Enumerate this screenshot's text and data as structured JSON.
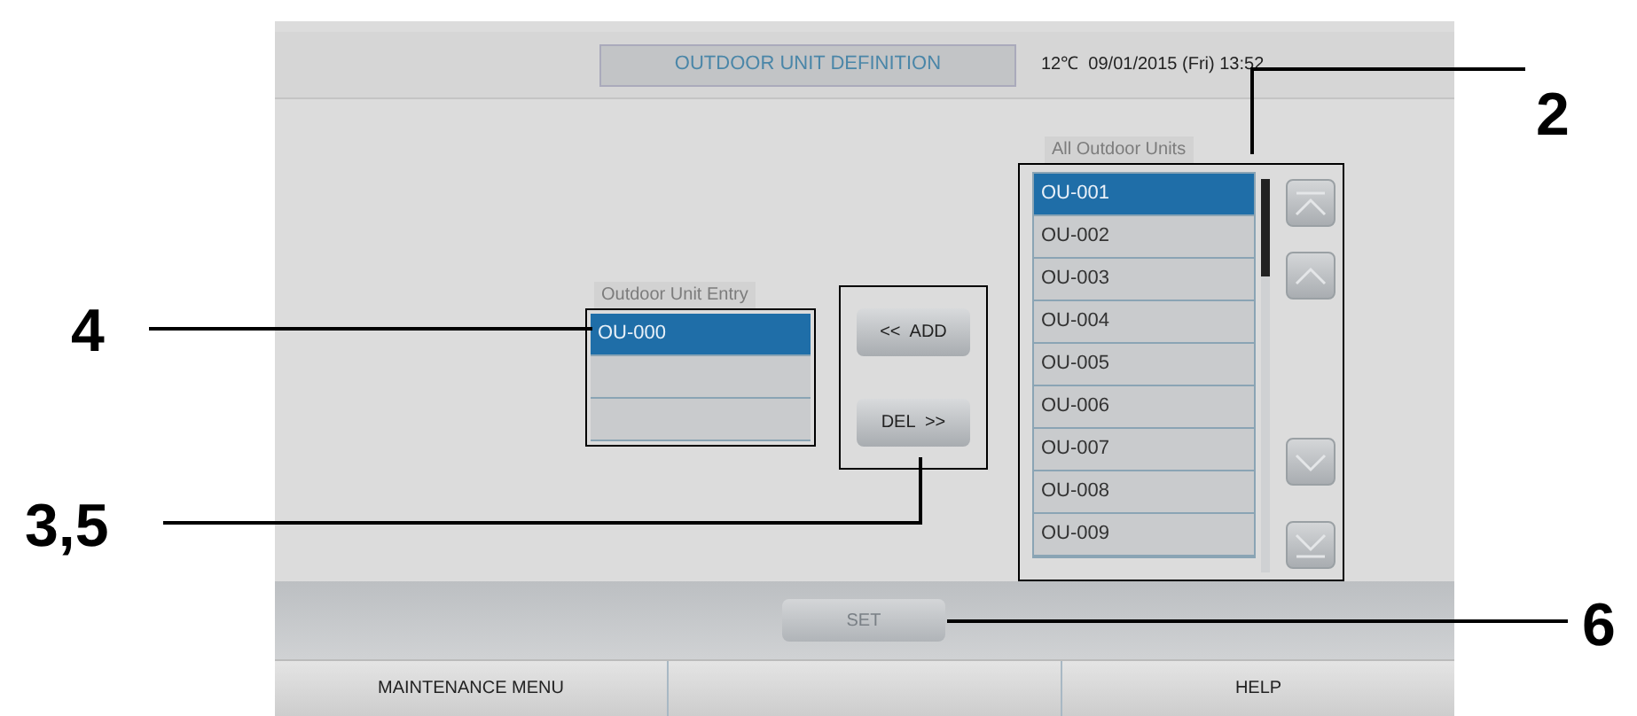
{
  "header": {
    "title": "OUTDOOR UNIT DEFINITION",
    "status": "12℃  09/01/2015 (Fri) 13:52"
  },
  "entry_list": {
    "label": "Outdoor Unit Entry",
    "rows": [
      {
        "text": "OU-000",
        "selected": true
      },
      {
        "selected": false
      },
      {
        "selected": false
      }
    ]
  },
  "move_buttons": [
    "<<  ADD",
    "DEL  >>"
  ],
  "all_units": {
    "label": "All Outdoor Units",
    "rows": [
      {
        "text": "OU-001",
        "selected": true
      },
      {
        "text": "OU-002",
        "selected": false
      },
      {
        "text": "OU-003",
        "selected": false
      },
      {
        "text": "OU-004",
        "selected": false
      },
      {
        "text": "OU-005",
        "selected": false
      },
      {
        "text": "OU-006",
        "selected": false
      },
      {
        "text": "OU-007",
        "selected": false
      },
      {
        "text": "OU-008",
        "selected": false
      },
      {
        "text": "OU-009",
        "selected": false
      }
    ]
  },
  "set_button": {
    "label": "SET",
    "disabled": true
  },
  "footer": {
    "left_button": "MAINTENANCE MENU",
    "right_button": "HELP"
  },
  "callouts": [
    "2",
    "4",
    "3,5",
    "6"
  ]
}
